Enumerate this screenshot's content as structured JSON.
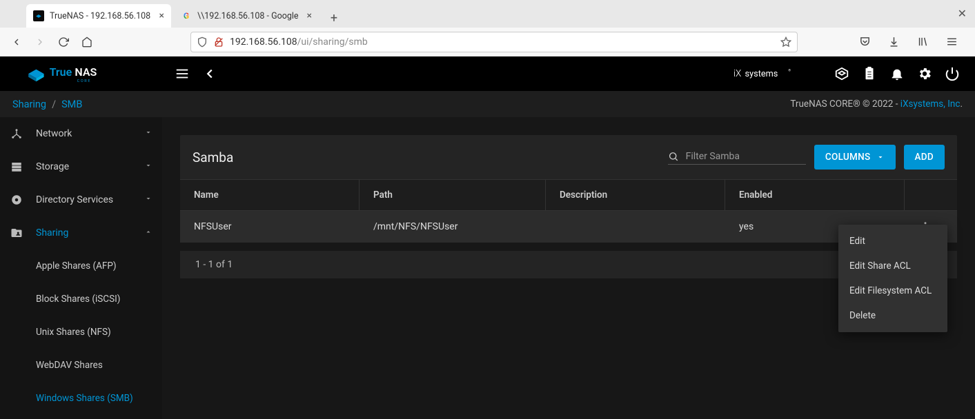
{
  "browser": {
    "tabs": [
      {
        "label": "TrueNAS - 192.168.56.108",
        "active": true
      },
      {
        "label": "\\\\192.168.56.108 - Google",
        "active": false
      }
    ],
    "url_display_host": "192.168.56.108",
    "url_display_path": "/ui/sharing/smb"
  },
  "header": {
    "ix_brand": "iXsystems"
  },
  "breadcrumb": {
    "root": "Sharing",
    "current": "SMB",
    "right_prefix": "TrueNAS CORE® © 2022 - ",
    "right_link": "iXsystems, Inc",
    "right_suffix": "."
  },
  "sidebar": {
    "items": [
      {
        "label": "Network",
        "icon": "network",
        "expandable": true
      },
      {
        "label": "Storage",
        "icon": "storage",
        "expandable": true
      },
      {
        "label": "Directory Services",
        "icon": "directory",
        "expandable": true
      },
      {
        "label": "Sharing",
        "icon": "sharing",
        "expandable": true,
        "active": true,
        "expanded": true
      }
    ],
    "sharing_children": [
      {
        "label": "Apple Shares (AFP)"
      },
      {
        "label": "Block Shares (iSCSI)"
      },
      {
        "label": "Unix Shares (NFS)"
      },
      {
        "label": "WebDAV Shares"
      },
      {
        "label": "Windows Shares (SMB)",
        "active": true
      }
    ]
  },
  "card": {
    "title": "Samba",
    "search_placeholder": "Filter Samba",
    "columns_btn": "COLUMNS",
    "add_btn": "ADD",
    "columns": {
      "name": "Name",
      "path": "Path",
      "description": "Description",
      "enabled": "Enabled"
    },
    "rows": [
      {
        "name": "NFSUser",
        "path": "/mnt/NFS/NFSUser",
        "description": "",
        "enabled": "yes"
      }
    ],
    "pager": "1 - 1 of 1"
  },
  "context_menu": {
    "items": [
      {
        "label": "Edit"
      },
      {
        "label": "Edit Share ACL"
      },
      {
        "label": "Edit Filesystem ACL"
      },
      {
        "label": "Delete"
      }
    ]
  }
}
